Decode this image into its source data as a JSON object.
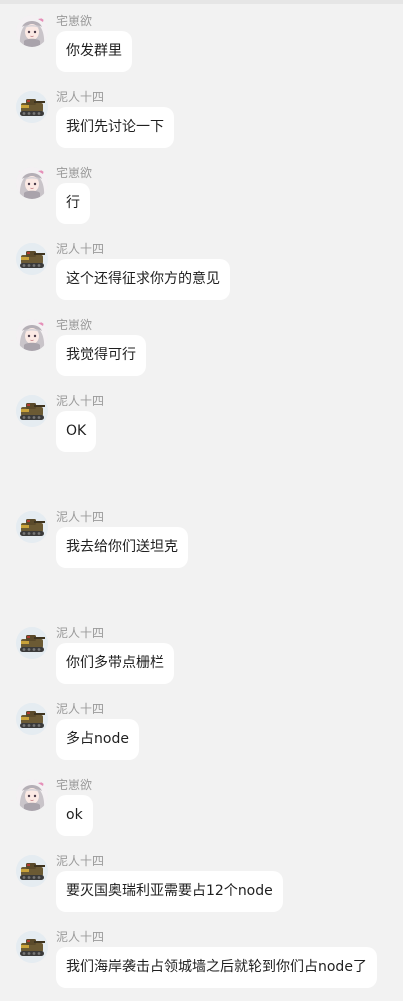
{
  "participants": {
    "zhai": {
      "name": "宅崽欲",
      "avatar_icon": "white-haired-anime-girl-avatar-icon"
    },
    "niren": {
      "name": "泥人十四",
      "avatar_icon": "tank-avatar-icon"
    }
  },
  "messages": [
    {
      "sender": "宅崽欲",
      "text": "你发群里"
    },
    {
      "sender": "泥人十四",
      "text": "我们先讨论一下"
    },
    {
      "sender": "宅崽欲",
      "text": "行"
    },
    {
      "sender": "泥人十四",
      "text": "这个还得征求你方的意见"
    },
    {
      "sender": "宅崽欲",
      "text": "我觉得可行"
    },
    {
      "sender": "泥人十四",
      "text": "OK"
    },
    {
      "sender": "泥人十四",
      "text": "我去给你们送坦克"
    },
    {
      "sender": "泥人十四",
      "text": "你们多带点栅栏"
    },
    {
      "sender": "泥人十四",
      "text": "多占node"
    },
    {
      "sender": "宅崽欲",
      "text": "ok"
    },
    {
      "sender": "泥人十四",
      "text": "要灭国奥瑞利亚需要占12个node"
    },
    {
      "sender": "泥人十四",
      "text": "我们海岸袭击占领城墙之后就轮到你们占node了"
    }
  ],
  "colors": {
    "background": "#f2f2f2",
    "bubble": "#ffffff",
    "sender_name": "#9a9a9a",
    "text": "#1f1f1f"
  }
}
